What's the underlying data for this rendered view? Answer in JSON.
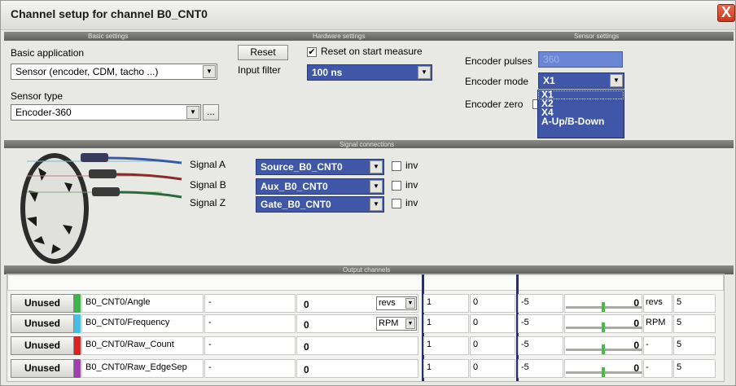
{
  "window": {
    "title": "Channel setup for channel B0_CNT0",
    "close_glyph": "X"
  },
  "bands": {
    "basic": "Basic settings",
    "hardware": "Hardware settings",
    "sensor": "Sensor settings",
    "signal": "Signal connections",
    "output": "Output channels"
  },
  "basic": {
    "app_label": "Basic application",
    "app_value": "Sensor (encoder, CDM, tacho ...)",
    "sensor_type_label": "Sensor type",
    "sensor_type_value": "Encoder-360",
    "browse_label": "..."
  },
  "hardware": {
    "reset_label": "Reset",
    "reset_on_start_label": "Reset on start measure",
    "reset_on_start_checked": "✔",
    "input_filter_label": "Input filter",
    "input_filter_value": "100 ns"
  },
  "sensor": {
    "pulses_label": "Encoder pulses",
    "pulses_value": "360",
    "mode_label": "Encoder mode",
    "mode_value": "X1",
    "zero_label": "Encoder zero",
    "mode_options": [
      "X1",
      "X2",
      "X4",
      "A-Up/B-Down"
    ]
  },
  "signals": [
    {
      "label": "Signal A",
      "source": "Source_B0_CNT0",
      "inv": "inv"
    },
    {
      "label": "Signal B",
      "source": "Aux_B0_CNT0",
      "inv": "inv"
    },
    {
      "label": "Signal Z",
      "source": "Gate_B0_CNT0",
      "inv": "inv"
    }
  ],
  "colors": {
    "accent": "#3f57a6",
    "row_colors": [
      "#3cb44a",
      "#46bde6",
      "#e02020",
      "#a040b0"
    ]
  },
  "outputs": [
    {
      "button": "Unused",
      "name": "B0_CNT0/Angle",
      "desc": "-",
      "value": "0",
      "unit": "revs",
      "c1": "1",
      "c2": "0",
      "c3": "-5",
      "v2": "0",
      "u2": "revs",
      "c4": "5"
    },
    {
      "button": "Unused",
      "name": "B0_CNT0/Frequency",
      "desc": "-",
      "value": "0",
      "unit": "RPM",
      "c1": "1",
      "c2": "0",
      "c3": "-5",
      "v2": "0",
      "u2": "RPM",
      "c4": "5"
    },
    {
      "button": "Unused",
      "name": "B0_CNT0/Raw_Count",
      "desc": "-",
      "value": "0",
      "unit": "",
      "c1": "1",
      "c2": "0",
      "c3": "-5",
      "v2": "0",
      "u2": "-",
      "c4": "5"
    },
    {
      "button": "Unused",
      "name": "B0_CNT0/Raw_EdgeSep",
      "desc": "-",
      "value": "0",
      "unit": "",
      "c1": "1",
      "c2": "0",
      "c3": "-5",
      "v2": "0",
      "u2": "-",
      "c4": "5"
    }
  ]
}
